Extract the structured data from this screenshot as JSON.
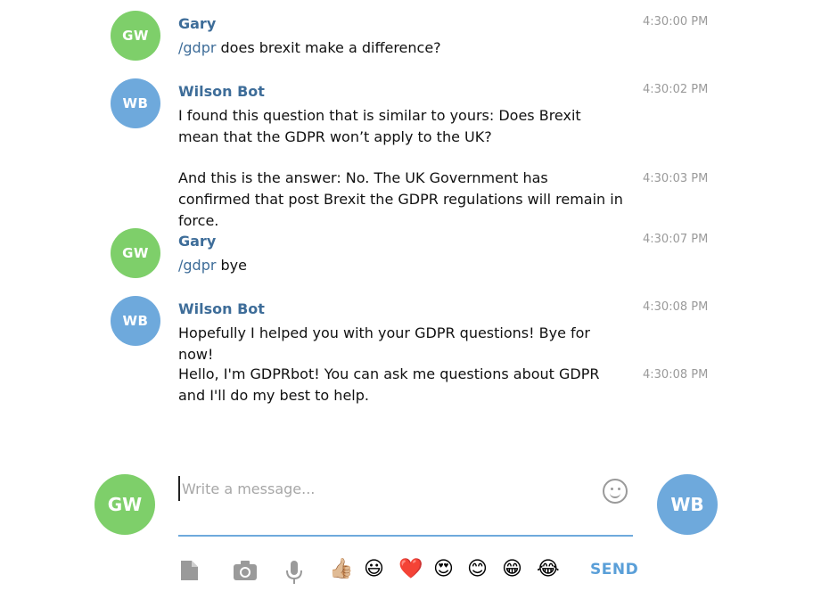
{
  "messages": [
    {
      "avatar": "GW",
      "sender": "Gary",
      "command": "/gdpr",
      "text": " does brexit make a difference?",
      "time": "4:30:00 PM"
    },
    {
      "avatar": "WB",
      "sender": "Wilson Bot",
      "text": "I found this question that is similar to yours: Does Brexit mean that the GDPR won’t apply to the UK?",
      "time": "4:30:02 PM"
    },
    {
      "text": "And this is the answer: No. The UK Government has confirmed that post Brexit the GDPR regulations will remain in force.",
      "time": "4:30:03 PM"
    },
    {
      "avatar": "GW",
      "sender": "Gary",
      "command": "/gdpr",
      "text": " bye",
      "time": "4:30:07 PM"
    },
    {
      "avatar": "WB",
      "sender": "Wilson Bot",
      "text": "Hopefully I helped you with your GDPR questions! Bye for now!",
      "time": "4:30:08 PM"
    },
    {
      "text": "Hello, I'm GDPRbot! You can ask me questions about GDPR and I'll do my best to help.",
      "time": "4:30:08 PM"
    }
  ],
  "composer": {
    "user_avatar": "GW",
    "bot_avatar": "WB",
    "placeholder": "Write a message...",
    "send_label": "SEND"
  },
  "toolbar": {
    "icons": [
      "file-icon",
      "camera-icon",
      "microphone-icon"
    ],
    "emojis": [
      "👍🏼",
      "😃",
      "❤️",
      "😍",
      "😊",
      "😁",
      "😂"
    ]
  },
  "colors": {
    "user_avatar": "#7ecf6a",
    "bot_avatar": "#6ea9dc",
    "sender_name": "#3e6d99",
    "timestamp": "#9a9a9a",
    "send": "#5a9fd8"
  }
}
